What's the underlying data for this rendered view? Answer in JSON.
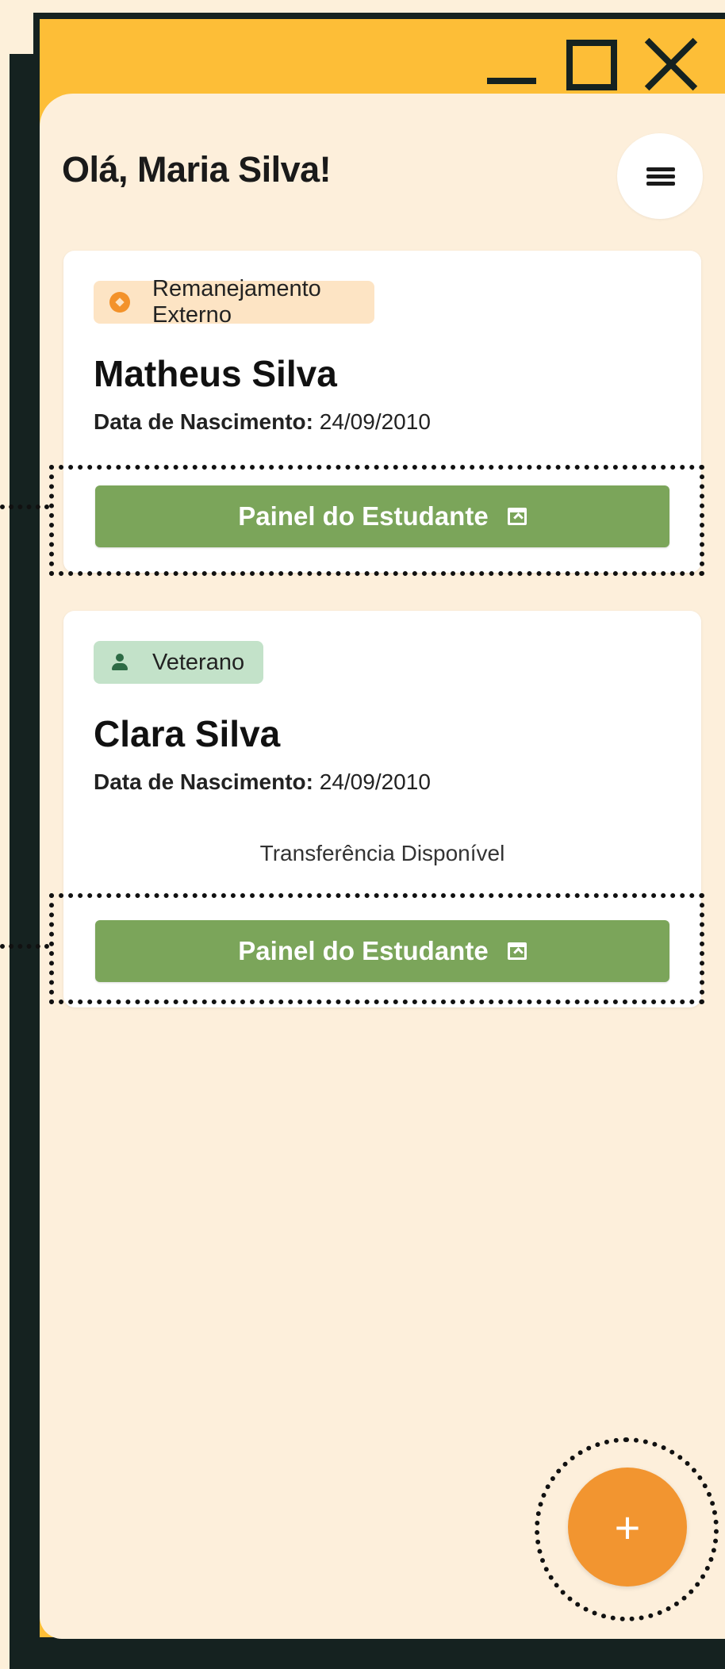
{
  "window": {
    "controls": [
      "minimize",
      "maximize",
      "close"
    ]
  },
  "header": {
    "greeting": "Olá, Maria Silva!",
    "menu_icon": "menu-icon"
  },
  "students": [
    {
      "tag": "Remanejamento Externo",
      "tag_icon": "compass-icon",
      "tag_color": "#FDE4C4",
      "name": "Matheus Silva",
      "dob_label": "Data de Nascimento:",
      "dob_value": "24/09/2010",
      "note": "",
      "button_label": "Painel do Estudante",
      "button_icon": "open-in-new-icon"
    },
    {
      "tag": "Veterano",
      "tag_icon": "person-icon",
      "tag_color": "#C3E2C9",
      "name": "Clara Silva",
      "dob_label": "Data de Nascimento:",
      "dob_value": "24/09/2010",
      "note": "Transferência Disponível",
      "button_label": "Painel do Estudante",
      "button_icon": "open-in-new-icon"
    }
  ],
  "fab": {
    "label": "+",
    "icon": "plus-icon"
  },
  "colors": {
    "window_bar": "#FDBE37",
    "frame": "#152220",
    "app_background": "#FDEFDB",
    "primary_button": "#7BA55A",
    "fab": "#F29530"
  }
}
